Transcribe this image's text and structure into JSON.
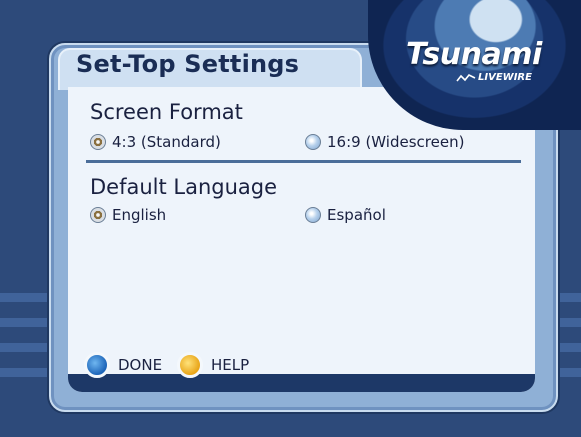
{
  "title": "Set-Top Settings",
  "logo": {
    "name": "Tsunami",
    "sub": "LIVEWIRE"
  },
  "sections": {
    "screen_format": {
      "heading": "Screen Format",
      "options": [
        {
          "label": "4:3 (Standard)",
          "selected": true
        },
        {
          "label": "16:9 (Widescreen)",
          "selected": false
        }
      ]
    },
    "default_language": {
      "heading": "Default Language",
      "options": [
        {
          "label": "English",
          "selected": true
        },
        {
          "label": "Español",
          "selected": false
        }
      ]
    }
  },
  "buttons": {
    "done": {
      "label": "DONE",
      "color": "blue"
    },
    "help": {
      "label": "HELP",
      "color": "yellow"
    }
  }
}
